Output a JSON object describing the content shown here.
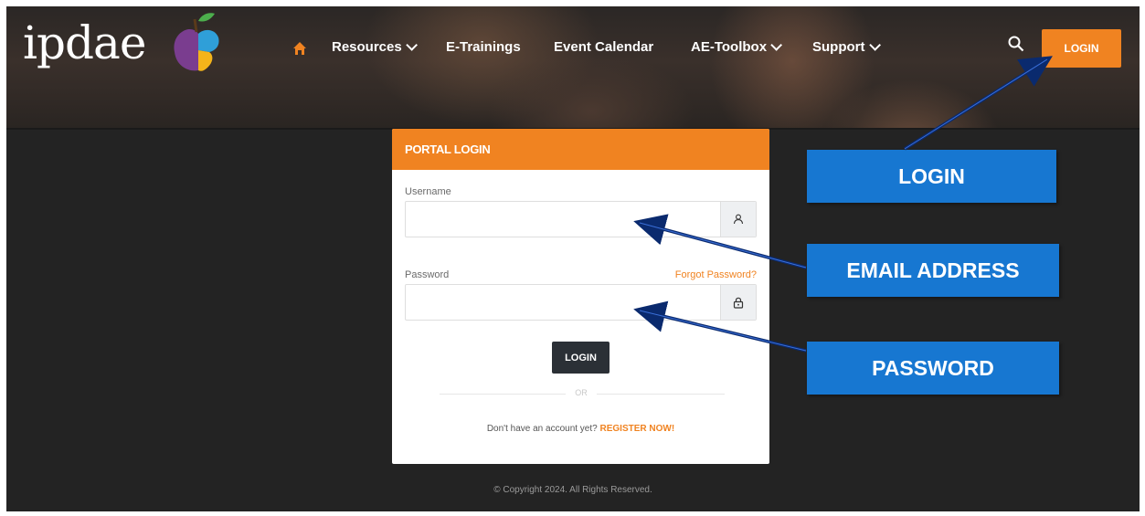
{
  "brand": {
    "logo_text": "ipdae",
    "colors": {
      "accent": "#f08321",
      "dark_button": "#2b3036",
      "callout": "#1777d1",
      "page_bg": "#232323"
    }
  },
  "nav": {
    "home_icon": "home-icon",
    "items": [
      {
        "label": "Resources",
        "has_dropdown": true
      },
      {
        "label": "E-Trainings",
        "has_dropdown": false
      },
      {
        "label": "Event Calendar",
        "has_dropdown": false
      },
      {
        "label": "AE-Toolbox",
        "has_dropdown": true
      },
      {
        "label": "Support",
        "has_dropdown": true
      }
    ],
    "search_icon": "search-icon",
    "login_label": "LOGIN"
  },
  "portal": {
    "title": "PORTAL LOGIN",
    "username_label": "Username",
    "username_value": "",
    "username_icon": "user-icon",
    "password_label": "Password",
    "password_value": "",
    "password_icon": "lock-icon",
    "forgot_label": "Forgot Password?",
    "login_label": "LOGIN",
    "or_label": "OR",
    "no_account_text": "Don't have an account yet?",
    "register_label": "REGISTER NOW!"
  },
  "footer": {
    "copyright": "© Copyright 2024. All Rights Reserved."
  },
  "annotations": {
    "login": "LOGIN",
    "email": "EMAIL ADDRESS",
    "password": "PASSWORD"
  }
}
